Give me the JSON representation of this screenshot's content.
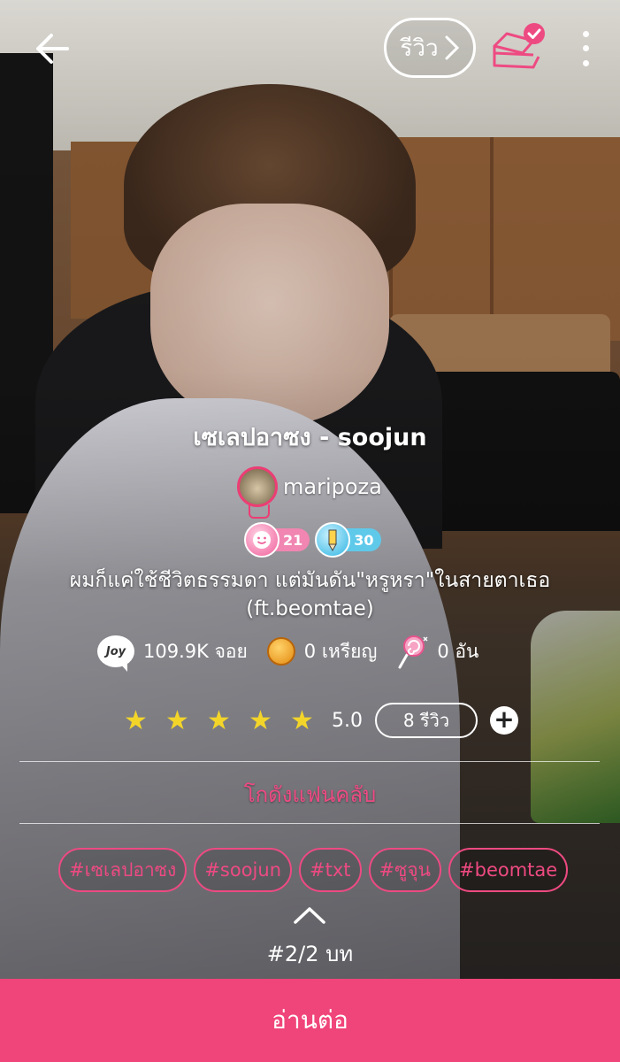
{
  "top_bar": {
    "review_label": "รีวิว"
  },
  "story": {
    "title": "เซเลปอาซง - soojun",
    "author": "maripoza",
    "badges": [
      {
        "type": "pink",
        "value": "21"
      },
      {
        "type": "blue",
        "value": "30"
      }
    ],
    "description": "ผมก็แค่ใช้ชีวิตธรรมดา แต่มันดัน\"หรูหรา\"ในสายตาเธอ (ft.beomtae)"
  },
  "stats": {
    "joy_icon_text": "Joy",
    "joy": "109.9K จอย",
    "coins": "0 เหรียญ",
    "candy": "0 อัน"
  },
  "rating": {
    "stars": 5,
    "value": "5.0",
    "review_count": "8 รีวิว",
    "add_label": "+"
  },
  "fanclub_label": "โกดังแฟนคลับ",
  "tags": [
    "#เซเลปอาซง",
    "#soojun",
    "#txt",
    "#ซูจุน",
    "#beomtae"
  ],
  "chapter": "#2/2 บท",
  "read_button": "อ่านต่อ",
  "colors": {
    "accent": "#f0457a",
    "tag_pink": "#ee4a82",
    "star": "#f3d52a"
  }
}
